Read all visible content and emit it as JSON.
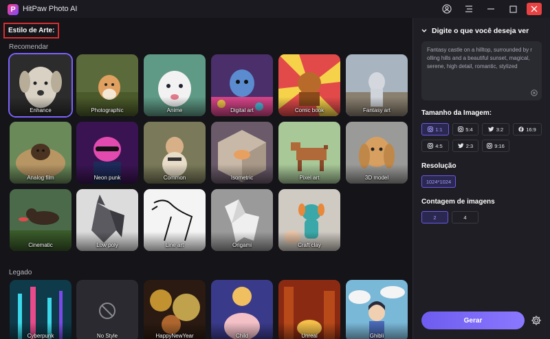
{
  "window": {
    "title": "HitPaw Photo AI",
    "logo_letter": "P"
  },
  "left": {
    "section_title": "Estilo de Arte:",
    "groups": {
      "recommended": "Recomendar",
      "legacy": "Legado"
    },
    "recommended_styles": [
      {
        "label": "Enhance",
        "selected": true
      },
      {
        "label": "Photographic"
      },
      {
        "label": "Anime"
      },
      {
        "label": "Digital art"
      },
      {
        "label": "Comic book"
      },
      {
        "label": "Fantasy art"
      },
      {
        "label": "Analog film"
      },
      {
        "label": "Neon punk"
      },
      {
        "label": "Common"
      },
      {
        "label": "Isometric"
      },
      {
        "label": "Pixel art"
      },
      {
        "label": "3D model"
      },
      {
        "label": "Cinematic"
      },
      {
        "label": "Low poly"
      },
      {
        "label": "Line art"
      },
      {
        "label": "Origami"
      },
      {
        "label": "Craft clay"
      }
    ],
    "legacy_styles": [
      {
        "label": "Cyberpunk"
      },
      {
        "label": "No Style"
      },
      {
        "label": "HappyNewYear"
      },
      {
        "label": "Child"
      },
      {
        "label": "Unreal"
      },
      {
        "label": "Ghibli"
      }
    ]
  },
  "right": {
    "prompt_header": "Digite o que você deseja ver",
    "prompt_text": "Fantasy castle on a hilltop, surrounded by r olling hills and a beautiful sunset, magical, serene, high detail, romantic, stylized",
    "size_label": "Tamanho da Imagem:",
    "sizes": [
      {
        "label": "1:1",
        "icon": "instagram-icon",
        "active": true
      },
      {
        "label": "5:4",
        "icon": "instagram-icon"
      },
      {
        "label": "3:2",
        "icon": "twitter-icon"
      },
      {
        "label": "16:9",
        "icon": "facebook-icon"
      },
      {
        "label": "4:5",
        "icon": "instagram-icon"
      },
      {
        "label": "2:3",
        "icon": "twitter-icon"
      },
      {
        "label": "9:16",
        "icon": "instagram-icon"
      }
    ],
    "resolution_label": "Resolução",
    "resolution_value": "1024*1024",
    "count_label": "Contagem de imagens",
    "counts": [
      {
        "label": "2",
        "active": true
      },
      {
        "label": "4"
      }
    ],
    "generate_label": "Gerar"
  },
  "colors": {
    "accent": "#7b64ff",
    "highlight_box": "#d63030",
    "close": "#e84242"
  }
}
